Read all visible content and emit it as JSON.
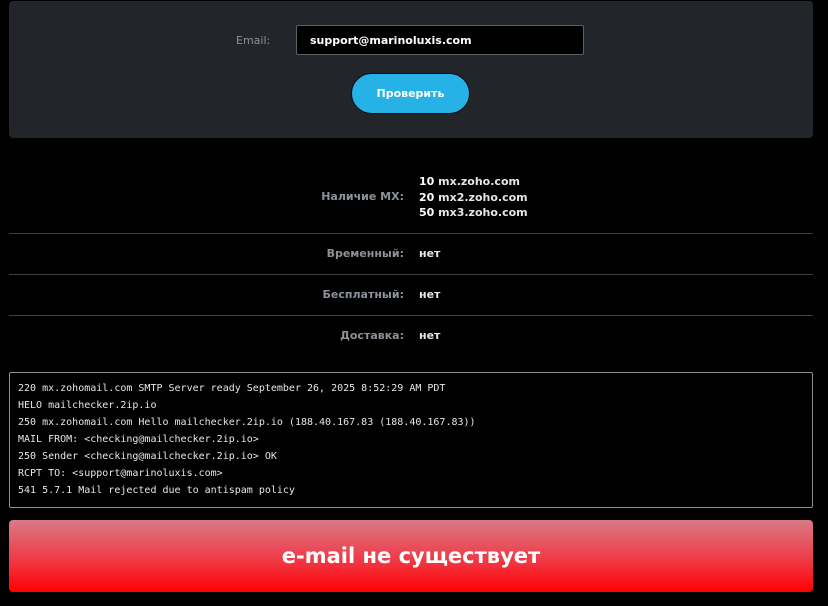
{
  "form": {
    "email_label": "Email:",
    "email_value": "support@marinoluxis.com",
    "submit_label": "Проверить"
  },
  "results": {
    "mx": {
      "label": "Наличие MX:",
      "records": [
        {
          "priority": "10",
          "host": "mx.zoho.com"
        },
        {
          "priority": "20",
          "host": "mx2.zoho.com"
        },
        {
          "priority": "50",
          "host": "mx3.zoho.com"
        }
      ]
    },
    "temporary": {
      "label": "Временный:",
      "value": "нет"
    },
    "free": {
      "label": "Бесплатный:",
      "value": "нет"
    },
    "delivery": {
      "label": "Доставка:",
      "value": "нет"
    }
  },
  "log": [
    "220 mx.zohomail.com SMTP Server ready September 26, 2025 8:52:29 AM PDT",
    "HELO mailchecker.2ip.io",
    "250 mx.zohomail.com Hello mailchecker.2ip.io (188.40.167.83 (188.40.167.83))",
    "MAIL FROM: <checking@mailchecker.2ip.io>",
    "250 Sender <checking@mailchecker.2ip.io> OK",
    "RCPT TO: <support@marinoluxis.com>",
    "541 5.7.1 Mail rejected due to antispam policy"
  ],
  "verdict": "e-mail не существует",
  "colors": {
    "panel_bg": "#22252a",
    "button_bg": "#26b2e6",
    "verdict_red": "#ff0000"
  }
}
